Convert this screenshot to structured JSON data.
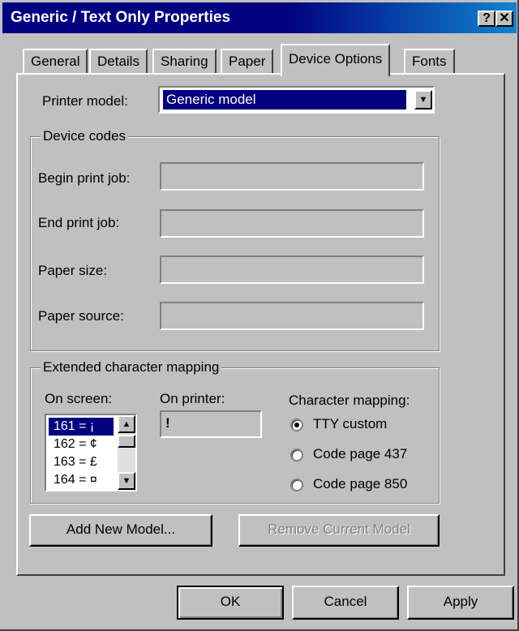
{
  "window": {
    "title": "Generic / Text Only Properties"
  },
  "titlebar_buttons": {
    "help": "?",
    "close": "✕"
  },
  "tabs": [
    "General",
    "Details",
    "Sharing",
    "Paper",
    "Device Options",
    "Fonts"
  ],
  "active_tab": "Device Options",
  "printer_model": {
    "label": "Printer model:",
    "value": "Generic model"
  },
  "device_codes": {
    "title": "Device codes",
    "begin_print_job": {
      "label": "Begin print job:",
      "value": ""
    },
    "end_print_job": {
      "label": "End print job:",
      "value": ""
    },
    "paper_size": {
      "label": "Paper size:",
      "value": ""
    },
    "paper_source": {
      "label": "Paper source:",
      "value": ""
    }
  },
  "extended_mapping": {
    "title": "Extended character mapping",
    "on_screen_label": "On screen:",
    "on_screen_items": [
      "161 = ¡",
      "162 = ¢",
      "163 = £",
      "164 = ¤"
    ],
    "on_printer_label": "On printer:",
    "on_printer_value": "!",
    "character_mapping_label": "Character mapping:",
    "options": [
      "TTY custom",
      "Code page 437",
      "Code page 850"
    ],
    "selected_option": "TTY custom"
  },
  "buttons": {
    "add_new_model": "Add New Model...",
    "remove_current_model": "Remove Current Model",
    "ok": "OK",
    "cancel": "Cancel",
    "apply": "Apply"
  }
}
